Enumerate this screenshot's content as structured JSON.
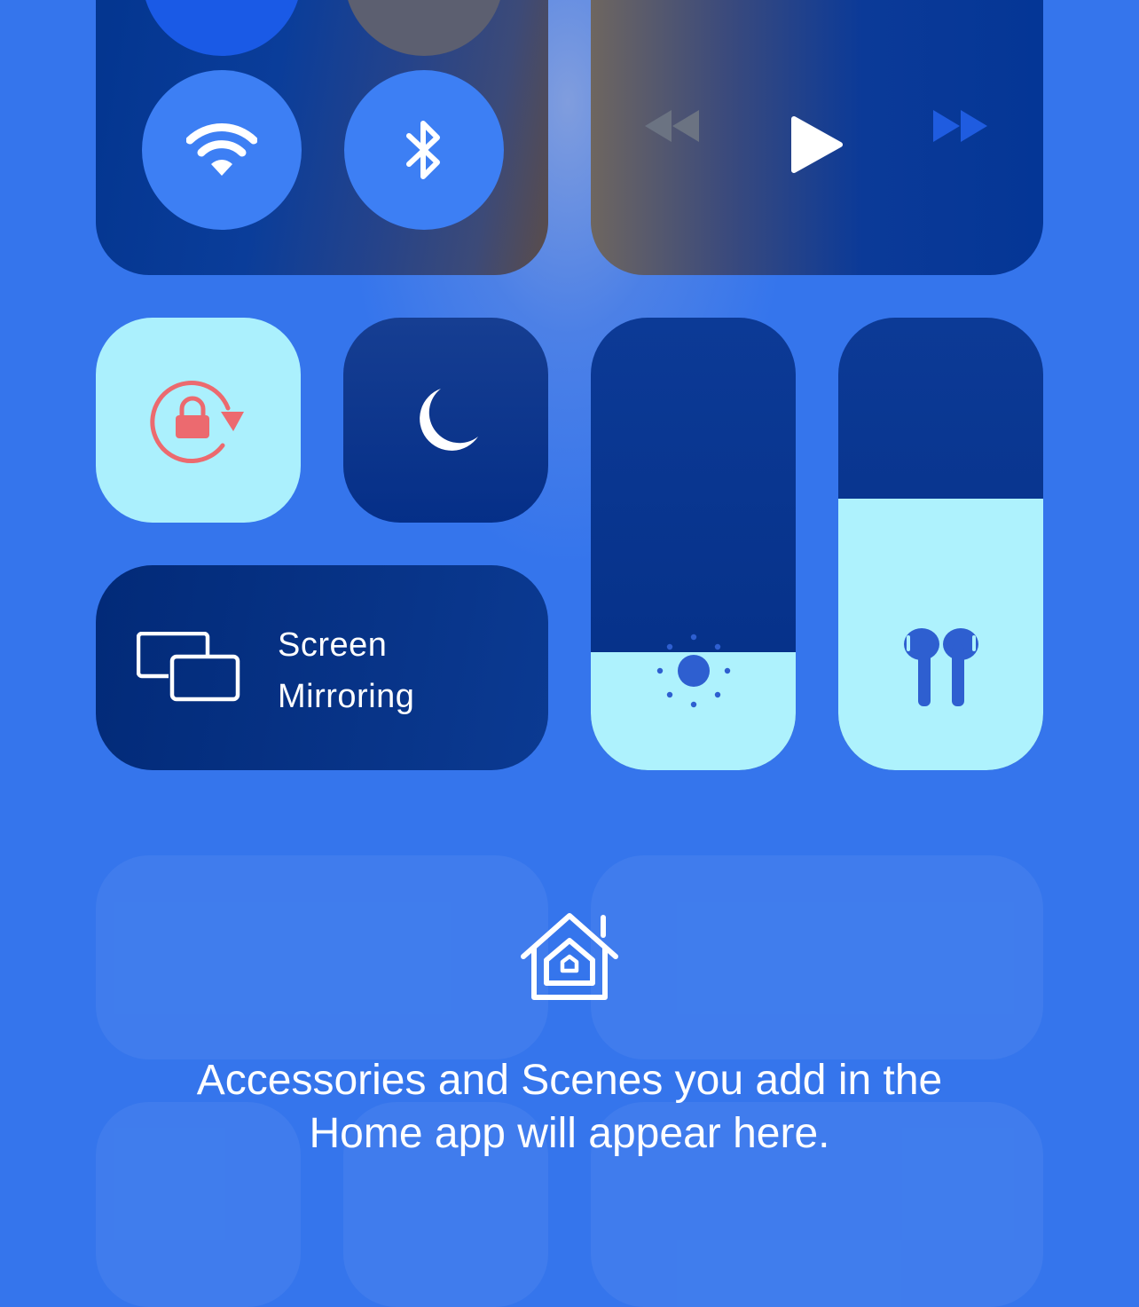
{
  "connectivity": {
    "wifi_icon": "wifi-icon",
    "bluetooth_icon": "bluetooth-icon",
    "accent_active": "#3d7ff4"
  },
  "media": {
    "rewind_icon": "rewind-icon",
    "play_icon": "play-icon",
    "fast_forward_icon": "fast-forward-icon"
  },
  "toggles": {
    "orientation_lock_icon": "rotation-lock-icon",
    "orientation_lock_color": "#abf0fd",
    "orientation_lock_glyph_color": "#ec6a6f",
    "do_not_disturb_icon": "moon-icon"
  },
  "screen_mirroring": {
    "label_line1": "Screen",
    "label_line2": "Mirroring",
    "icon": "screen-mirroring-icon"
  },
  "sliders": {
    "brightness": {
      "level": 0.26,
      "icon": "sun-icon"
    },
    "volume": {
      "level": 0.6,
      "icon": "airpods-icon"
    }
  },
  "home": {
    "icon": "home-icon",
    "message_line1": "Accessories and Scenes you add in the",
    "message_line2": "Home app will appear here."
  }
}
